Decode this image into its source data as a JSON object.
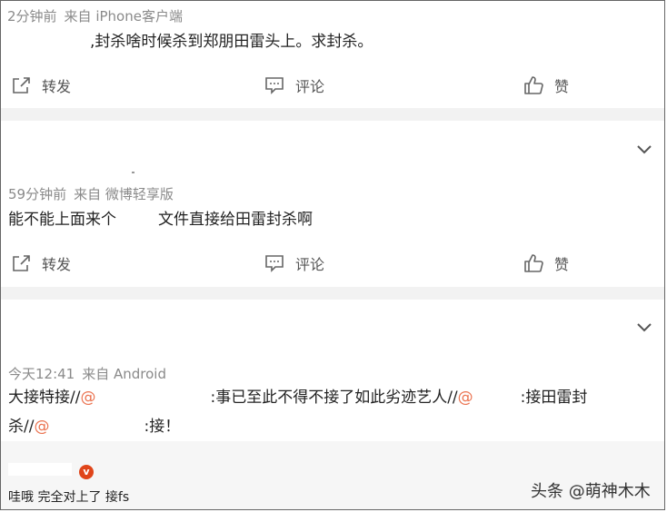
{
  "posts": [
    {
      "time": "2分钟前",
      "source": "来自 iPhone客户端",
      "text": ",封杀啥时候杀到郑朋田雷头上。求封杀。",
      "actions": {
        "repost": "转发",
        "comment": "评论",
        "like": "赞"
      }
    },
    {
      "time": "59分钟前",
      "source": "来自 微博轻享版",
      "text_a": "能不能上面来个",
      "text_b": "文件直接给田雷封杀啊",
      "actions": {
        "repost": "转发",
        "comment": "评论",
        "like": "赞"
      }
    },
    {
      "time": "今天12:41",
      "source": "来自 Android",
      "line1_a": "大接特接//",
      "mention1": "@",
      "line1_b": ":事已至此不得不接了如此劣迹艺人//",
      "mention2": "@",
      "line1_c": ":接田雷封",
      "line2_a": "杀//",
      "mention3": "@",
      "line2_b": ":接！"
    }
  ],
  "reply": {
    "badge": "v",
    "text": "哇哦 完全对上了 接fs"
  },
  "watermark": "头条 @萌神木木",
  "colors": {
    "mention": "#eb7350",
    "meta": "#8a8a8a",
    "divider": "#f2f2f2"
  }
}
